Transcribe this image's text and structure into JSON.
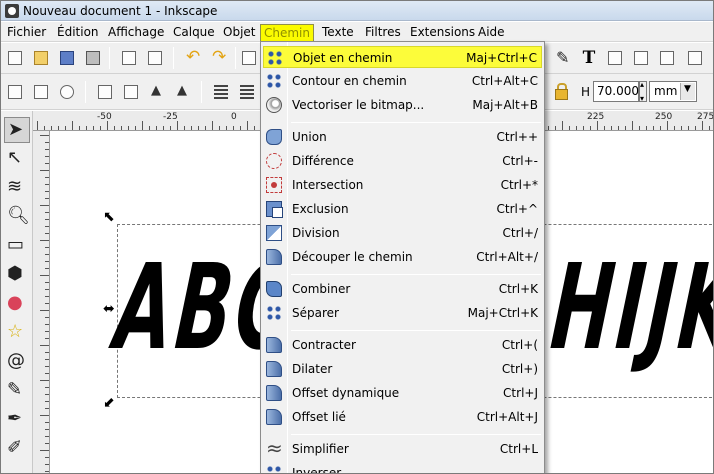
{
  "window": {
    "title": "Nouveau document 1 - Inkscape"
  },
  "menubar": {
    "items": [
      {
        "label": "Fichier"
      },
      {
        "label": "Édition"
      },
      {
        "label": "Affichage"
      },
      {
        "label": "Calque"
      },
      {
        "label": "Objet"
      },
      {
        "label": "Chemin",
        "active": true
      },
      {
        "label": "Texte"
      },
      {
        "label": "Filtres"
      },
      {
        "label": "Extensions"
      },
      {
        "label": "Aide"
      }
    ]
  },
  "toolbar2": {
    "h_label": "H",
    "h_value": "70.000",
    "unit": "mm"
  },
  "ruler": {
    "labels": [
      "-50",
      "-25",
      "0",
      "225",
      "250",
      "275"
    ]
  },
  "canvas": {
    "text_left": "ABC",
    "text_right": "HIJK"
  },
  "chemin_menu": {
    "items": [
      {
        "label": "Objet en chemin",
        "shortcut": "Maj+Ctrl+C",
        "icon": "object-to-path-icon",
        "highlighted": true
      },
      {
        "label": "Contour en chemin",
        "shortcut": "Ctrl+Alt+C",
        "icon": "stroke-to-path-icon"
      },
      {
        "label": "Vectoriser le bitmap...",
        "shortcut": "Maj+Alt+B",
        "icon": "trace-bitmap-icon"
      },
      {
        "label": "Union",
        "shortcut": "Ctrl++",
        "icon": "union-icon"
      },
      {
        "label": "Différence",
        "shortcut": "Ctrl+-",
        "icon": "difference-icon"
      },
      {
        "label": "Intersection",
        "shortcut": "Ctrl+*",
        "icon": "intersection-icon"
      },
      {
        "label": "Exclusion",
        "shortcut": "Ctrl+^",
        "icon": "exclusion-icon"
      },
      {
        "label": "Division",
        "shortcut": "Ctrl+/",
        "icon": "division-icon"
      },
      {
        "label": "Découper le chemin",
        "shortcut": "Ctrl+Alt+/",
        "icon": "cut-path-icon"
      },
      {
        "label": "Combiner",
        "shortcut": "Ctrl+K",
        "icon": "combine-icon"
      },
      {
        "label": "Séparer",
        "shortcut": "Maj+Ctrl+K",
        "icon": "break-apart-icon"
      },
      {
        "label": "Contracter",
        "shortcut": "Ctrl+(",
        "icon": "inset-icon"
      },
      {
        "label": "Dilater",
        "shortcut": "Ctrl+)",
        "icon": "outset-icon"
      },
      {
        "label": "Offset dynamique",
        "shortcut": "Ctrl+J",
        "icon": "dynamic-offset-icon"
      },
      {
        "label": "Offset lié",
        "shortcut": "Ctrl+Alt+J",
        "icon": "linked-offset-icon"
      },
      {
        "label": "Simplifier",
        "shortcut": "Ctrl+L",
        "icon": "simplify-icon"
      },
      {
        "label": "Inverser",
        "shortcut": "",
        "icon": "reverse-icon"
      }
    ]
  },
  "colors": {
    "highlight": "#fcfc3a",
    "menu_bg": "#f1f1f1",
    "toolbar_bg": "#f0f0f0"
  }
}
